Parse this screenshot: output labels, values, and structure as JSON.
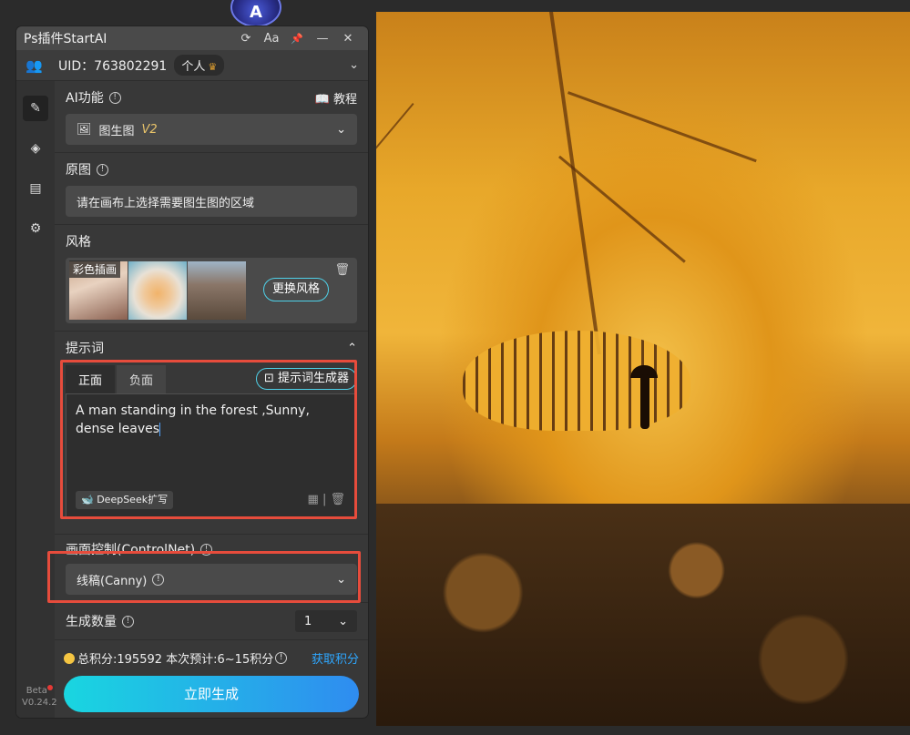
{
  "app": {
    "logo_text": "A",
    "title": "Ps插件StartAI",
    "title_buttons": [
      "⟳",
      "Aa",
      "📌",
      "—",
      "✕"
    ]
  },
  "user": {
    "uid": "UID：763802291",
    "plan": "个人"
  },
  "sidebar": {
    "version": "V0.24.2",
    "beta": "Beta"
  },
  "ai_function": {
    "label": "AI功能",
    "tutorial": "教程",
    "selected": "图生图",
    "version_badge": "V2"
  },
  "source_image": {
    "label": "原图",
    "placeholder": "请在画布上选择需要图生图的区域"
  },
  "style": {
    "label": "风格",
    "selected_name": "彩色插画",
    "change_button": "更换风格"
  },
  "prompt": {
    "label": "提示词",
    "tabs": [
      "正面",
      "负面"
    ],
    "generator_button": "提示词生成器",
    "text": "A man standing in the forest ,Sunny, dense leaves",
    "deepseek_button": "DeepSeek扩写"
  },
  "controlnet": {
    "label": "画面控制(ControlNet)",
    "selected": "线稿(Canny)"
  },
  "count": {
    "label": "生成数量",
    "value": "1"
  },
  "footer": {
    "points_text": "总积分:195592  本次预计:6~15积分",
    "get_points": "获取积分",
    "generate_button": "立即生成"
  },
  "colors": {
    "accent": "#2ea7ff",
    "highlight_box": "#e74c3c",
    "button_gradient_start": "#19d6e0",
    "button_gradient_end": "#2f8cf0"
  }
}
